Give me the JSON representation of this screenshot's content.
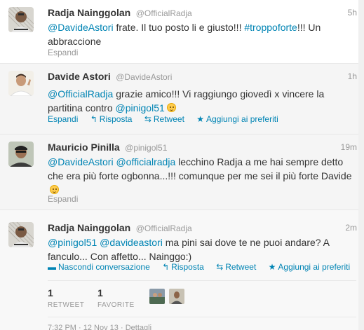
{
  "tweets": [
    {
      "name": "Radja Nainggolan",
      "handle": "@OfficialRadja",
      "time": "5h",
      "text": [
        {
          "t": "@DavideAstori",
          "link": true
        },
        {
          "t": " frate. Il tuo posto li e giusto!!! ",
          "link": false
        },
        {
          "t": "#troppoforte",
          "link": true
        },
        {
          "t": "!!! Un abbraccione",
          "link": false
        }
      ],
      "actions": {
        "expand": "Espandi"
      }
    },
    {
      "name": "Davide Astori",
      "handle": "@DavideAstori",
      "time": "1h",
      "text": [
        {
          "t": "@OfficialRadja",
          "link": true
        },
        {
          "t": " grazie amico!!! Vi raggiungo giovedì x vincere la partitina contro ",
          "link": false
        },
        {
          "t": "@pinigol51",
          "link": true
        }
      ],
      "actions": {
        "expand": "Espandi",
        "reply": "Risposta",
        "retweet": "Retweet",
        "favorite": "Aggiungi ai preferiti"
      }
    },
    {
      "name": "Mauricio Pinilla",
      "handle": "@pinigol51",
      "time": "19m",
      "text": [
        {
          "t": "@DavideAstori",
          "link": true
        },
        {
          "t": " ",
          "link": false
        },
        {
          "t": "@officialradja",
          "link": true
        },
        {
          "t": " lecchino Radja a me hai sempre detto che era più forte ogbonna...!!! comunque per me sei il più forte Davide",
          "link": false
        }
      ],
      "actions": {
        "expand": "Espandi"
      }
    },
    {
      "name": "Radja Nainggolan",
      "handle": "@OfficialRadja",
      "time": "2m",
      "text": [
        {
          "t": "@pinigol51",
          "link": true
        },
        {
          "t": " ",
          "link": false
        },
        {
          "t": "@davideastori",
          "link": true
        },
        {
          "t": " ma pini sai dove te ne puoi andare? A fanculo... Con affetto... Nainggo:)",
          "link": false
        }
      ],
      "actions": {
        "hide": "Nascondi conversazione",
        "reply": "Risposta",
        "retweet": "Retweet",
        "favorite": "Aggiungi ai preferiti"
      }
    }
  ],
  "stats": {
    "retweet_count": "1",
    "retweet_label": "RETWEET",
    "favorite_count": "1",
    "favorite_label": "FAVORITE"
  },
  "footer": {
    "time": "7:32 PM",
    "date": "12 Nov 13",
    "separator": "·",
    "details": "Dettagli"
  },
  "icons": {
    "reply": "reply-icon",
    "retweet": "retweet-icon",
    "favorite": "star-icon",
    "hide": "hide-conversation-icon"
  },
  "colors": {
    "link": "#0084b4",
    "meta": "#999999",
    "text": "#333333"
  }
}
